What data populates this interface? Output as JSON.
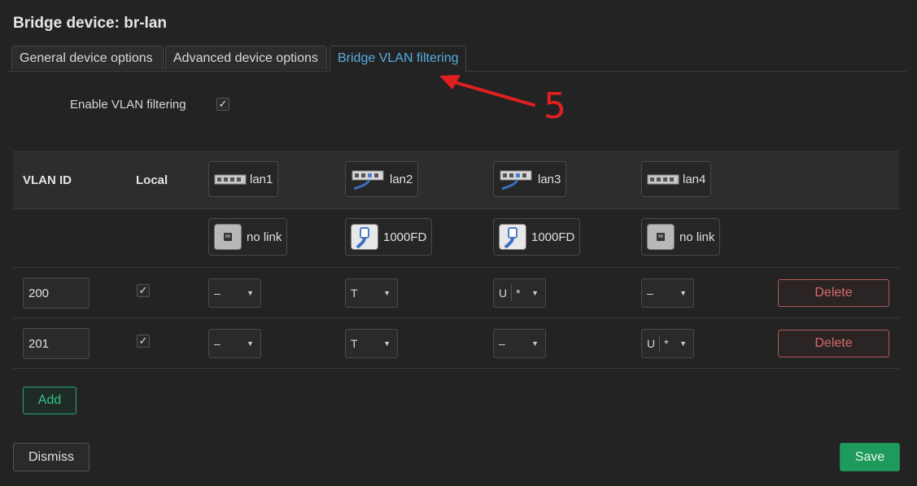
{
  "title": "Bridge device: br-lan",
  "tabs": [
    {
      "label": "General device options"
    },
    {
      "label": "Advanced device options"
    },
    {
      "label": "Bridge VLAN filtering"
    }
  ],
  "enable_vlan": {
    "label": "Enable VLAN filtering",
    "checked": true
  },
  "columns": {
    "vlan_id": "VLAN ID",
    "local": "Local"
  },
  "ports": [
    {
      "name": "lan1",
      "link": "no link"
    },
    {
      "name": "lan2",
      "link": "1000FD"
    },
    {
      "name": "lan3",
      "link": "1000FD"
    },
    {
      "name": "lan4",
      "link": "no link"
    }
  ],
  "rows": [
    {
      "vlan_id": "200",
      "local": true,
      "cells": [
        {
          "value": "–"
        },
        {
          "value": "T"
        },
        {
          "value": "U",
          "extra": "*"
        },
        {
          "value": "–"
        }
      ]
    },
    {
      "vlan_id": "201",
      "local": true,
      "cells": [
        {
          "value": "–"
        },
        {
          "value": "T"
        },
        {
          "value": "–"
        },
        {
          "value": "U",
          "extra": "*"
        }
      ]
    }
  ],
  "buttons": {
    "delete": "Delete",
    "add": "Add",
    "dismiss": "Dismiss",
    "save": "Save"
  },
  "annotation": {
    "label": "5",
    "color": "#e02020"
  },
  "colors": {
    "accent": "#55aee0",
    "danger": "#d86a6a",
    "success": "#1e9a5c"
  }
}
